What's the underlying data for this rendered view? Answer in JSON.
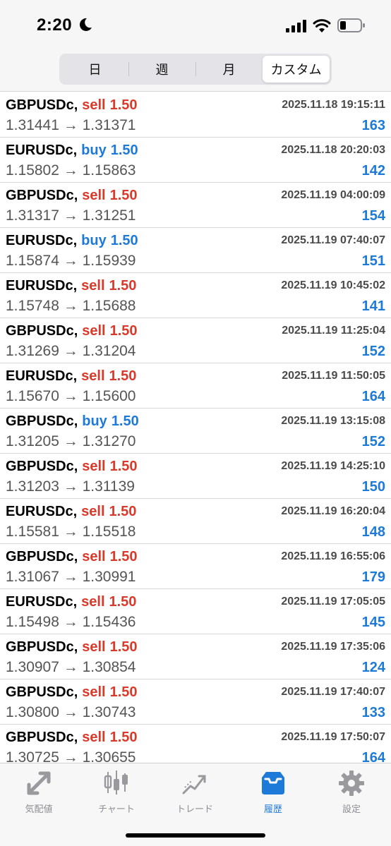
{
  "status_bar": {
    "time": "2:20"
  },
  "segments": [
    {
      "label": "日",
      "active": false
    },
    {
      "label": "週",
      "active": false
    },
    {
      "label": "月",
      "active": false
    },
    {
      "label": "カスタム",
      "active": true
    }
  ],
  "trades": [
    {
      "symbol": "GBPUSDc,",
      "side": "sell",
      "volume": "1.50",
      "prices": "1.31441 → 1.31371",
      "time": "2025.11.18 19:15:11",
      "profit": "163"
    },
    {
      "symbol": "EURUSDc,",
      "side": "buy",
      "volume": "1.50",
      "prices": "1.15802 → 1.15863",
      "time": "2025.11.18 20:20:03",
      "profit": "142"
    },
    {
      "symbol": "GBPUSDc,",
      "side": "sell",
      "volume": "1.50",
      "prices": "1.31317 → 1.31251",
      "time": "2025.11.19 04:00:09",
      "profit": "154"
    },
    {
      "symbol": "EURUSDc,",
      "side": "buy",
      "volume": "1.50",
      "prices": "1.15874 → 1.15939",
      "time": "2025.11.19 07:40:07",
      "profit": "151"
    },
    {
      "symbol": "EURUSDc,",
      "side": "sell",
      "volume": "1.50",
      "prices": "1.15748 → 1.15688",
      "time": "2025.11.19 10:45:02",
      "profit": "141"
    },
    {
      "symbol": "GBPUSDc,",
      "side": "sell",
      "volume": "1.50",
      "prices": "1.31269 → 1.31204",
      "time": "2025.11.19 11:25:04",
      "profit": "152"
    },
    {
      "symbol": "EURUSDc,",
      "side": "sell",
      "volume": "1.50",
      "prices": "1.15670 → 1.15600",
      "time": "2025.11.19 11:50:05",
      "profit": "164"
    },
    {
      "symbol": "GBPUSDc,",
      "side": "buy",
      "volume": "1.50",
      "prices": "1.31205 → 1.31270",
      "time": "2025.11.19 13:15:08",
      "profit": "152"
    },
    {
      "symbol": "GBPUSDc,",
      "side": "sell",
      "volume": "1.50",
      "prices": "1.31203 → 1.31139",
      "time": "2025.11.19 14:25:10",
      "profit": "150"
    },
    {
      "symbol": "EURUSDc,",
      "side": "sell",
      "volume": "1.50",
      "prices": "1.15581 → 1.15518",
      "time": "2025.11.19 16:20:04",
      "profit": "148"
    },
    {
      "symbol": "GBPUSDc,",
      "side": "sell",
      "volume": "1.50",
      "prices": "1.31067 → 1.30991",
      "time": "2025.11.19 16:55:06",
      "profit": "179"
    },
    {
      "symbol": "EURUSDc,",
      "side": "sell",
      "volume": "1.50",
      "prices": "1.15498 → 1.15436",
      "time": "2025.11.19 17:05:05",
      "profit": "145"
    },
    {
      "symbol": "GBPUSDc,",
      "side": "sell",
      "volume": "1.50",
      "prices": "1.30907 → 1.30854",
      "time": "2025.11.19 17:35:06",
      "profit": "124"
    },
    {
      "symbol": "GBPUSDc,",
      "side": "sell",
      "volume": "1.50",
      "prices": "1.30800 → 1.30743",
      "time": "2025.11.19 17:40:07",
      "profit": "133"
    },
    {
      "symbol": "GBPUSDc,",
      "side": "sell",
      "volume": "1.50",
      "prices": "1.30725 → 1.30655",
      "time": "2025.11.19 17:50:07",
      "profit": "164"
    }
  ],
  "colors": {
    "sell": "#d93a2b",
    "buy": "#1e7ad8",
    "profit": "#1e7ad8",
    "tab_active": "#1e7ad8",
    "tab_inactive": "#8e8e93"
  },
  "tabs": [
    {
      "label": "気配値",
      "icon": "quotes-icon",
      "active": false
    },
    {
      "label": "チャート",
      "icon": "chart-candles-icon",
      "active": false
    },
    {
      "label": "トレード",
      "icon": "trade-icon",
      "active": false
    },
    {
      "label": "履歴",
      "icon": "history-inbox-icon",
      "active": true
    },
    {
      "label": "設定",
      "icon": "gear-icon",
      "active": false
    }
  ]
}
